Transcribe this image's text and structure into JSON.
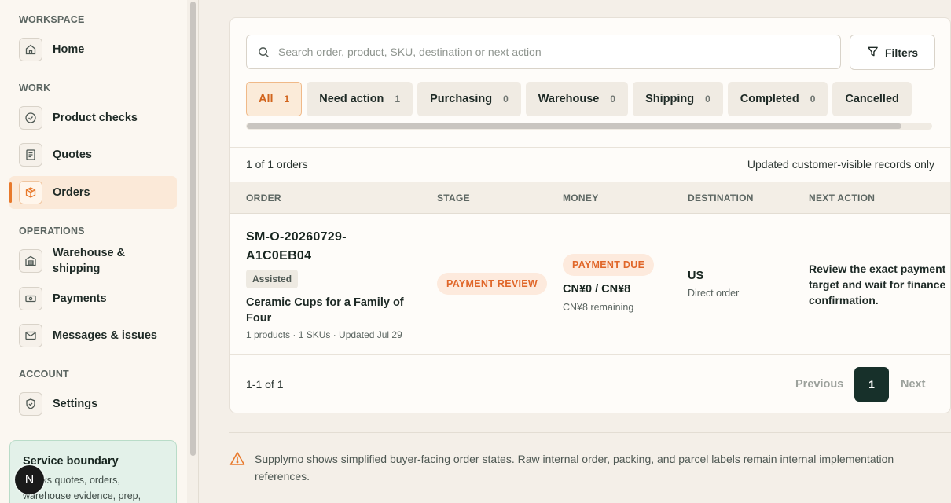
{
  "sidebar": {
    "sections": {
      "workspace": "WORKSPACE",
      "work": "WORK",
      "operations": "OPERATIONS",
      "account": "ACCOUNT"
    },
    "items": {
      "home": "Home",
      "product_checks": "Product checks",
      "quotes": "Quotes",
      "orders": "Orders",
      "warehouse_line1": "Warehouse &",
      "warehouse_line2": "shipping",
      "payments": "Payments",
      "messages": "Messages & issues",
      "settings": "Settings"
    },
    "service_card": {
      "title": "Service boundary",
      "body": "Tracks quotes, orders, warehouse evidence, prep,"
    },
    "avatar_initial": "N"
  },
  "search": {
    "placeholder": "Search order, product, SKU, destination or next action"
  },
  "filters_label": "Filters",
  "tabs": [
    {
      "label": "All",
      "count": "1"
    },
    {
      "label": "Need action",
      "count": "1"
    },
    {
      "label": "Purchasing",
      "count": "0"
    },
    {
      "label": "Warehouse",
      "count": "0"
    },
    {
      "label": "Shipping",
      "count": "0"
    },
    {
      "label": "Completed",
      "count": "0"
    },
    {
      "label": "Cancelled",
      "count": ""
    }
  ],
  "summary": {
    "count": "1 of 1 orders",
    "note": "Updated customer-visible records only"
  },
  "columns": [
    "ORDER",
    "STAGE",
    "MONEY",
    "DESTINATION",
    "NEXT ACTION"
  ],
  "order": {
    "id": "SM-O-20260729-A1C0EB04",
    "tag": "Assisted",
    "product": "Ceramic Cups for a Family of Four",
    "meta": "1 products · 1 SKUs · Updated Jul 29",
    "stage": "PAYMENT REVIEW",
    "money_status": "PAYMENT DUE",
    "money": "CN¥0 / CN¥8",
    "money_remaining": "CN¥8 remaining",
    "destination": "US",
    "destination_sub": "Direct order",
    "next_action": "Review the exact payment target and wait for finance confirmation."
  },
  "pagination": {
    "info": "1-1 of 1",
    "previous": "Previous",
    "current": "1",
    "next": "Next"
  },
  "notice": "Supplymo shows simplified buyer-facing order states. Raw internal order, packing, and parcel labels remain internal implementation references.",
  "colors": {
    "accent": "#e8792b",
    "dark": "#17302a",
    "pill_bg": "#fdeadd",
    "pill_text": "#e0672a"
  }
}
